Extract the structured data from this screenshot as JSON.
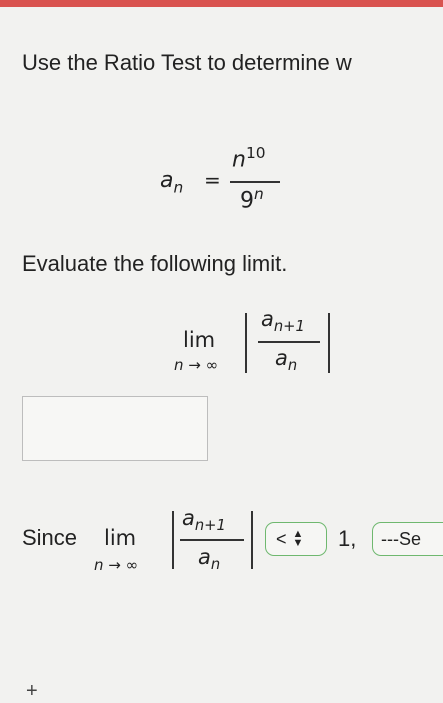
{
  "prompt": "Use the Ratio Test to determine w",
  "equation": {
    "lhs": "a",
    "lhs_sub": "n",
    "eq": "=",
    "num_base": "n",
    "num_exp": "10",
    "den_base": "9",
    "den_exp": "n"
  },
  "evaluate_label": "Evaluate the following limit.",
  "limit": {
    "lim": "lim",
    "sub": "n → ∞",
    "num": "a",
    "num_sub": "n+1",
    "den": "a",
    "den_sub": "n"
  },
  "answer": {
    "value": ""
  },
  "since_label": "Since",
  "comparison": {
    "selected": "<"
  },
  "one_label": "1,",
  "conclusion": {
    "selected": "---Se"
  },
  "plus": "+"
}
